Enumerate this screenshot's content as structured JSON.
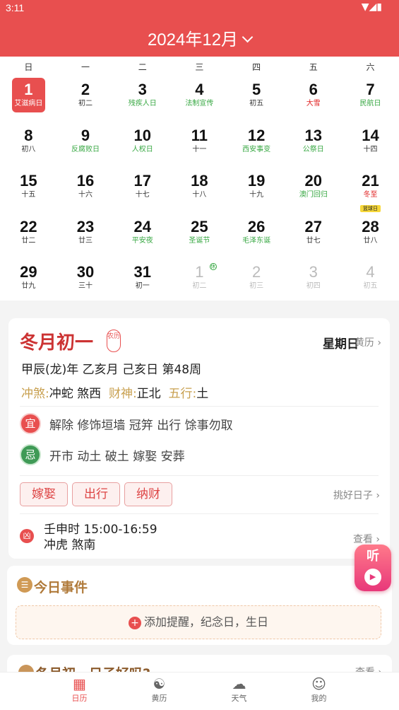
{
  "status_bar": {
    "time": "3:11",
    "icons": "▼◢▮"
  },
  "header": {
    "month_title": "2024年12月"
  },
  "weekdays": [
    "日",
    "一",
    "二",
    "三",
    "四",
    "五",
    "六"
  ],
  "days": [
    {
      "n": "1",
      "s": "艾滋病日",
      "type": "sel"
    },
    {
      "n": "2",
      "s": "初二"
    },
    {
      "n": "3",
      "s": "残疾人日",
      "type": "green"
    },
    {
      "n": "4",
      "s": "法制宣传",
      "type": "green"
    },
    {
      "n": "5",
      "s": "初五"
    },
    {
      "n": "6",
      "s": "大雪",
      "type": "red"
    },
    {
      "n": "7",
      "s": "民航日",
      "type": "green"
    },
    {
      "n": "8",
      "s": "初八"
    },
    {
      "n": "9",
      "s": "反腐败日",
      "type": "green"
    },
    {
      "n": "10",
      "s": "人权日",
      "type": "green"
    },
    {
      "n": "11",
      "s": "十一"
    },
    {
      "n": "12",
      "s": "西安事变",
      "type": "green"
    },
    {
      "n": "13",
      "s": "公祭日",
      "type": "green"
    },
    {
      "n": "14",
      "s": "十四"
    },
    {
      "n": "15",
      "s": "十五"
    },
    {
      "n": "16",
      "s": "十六"
    },
    {
      "n": "17",
      "s": "十七"
    },
    {
      "n": "18",
      "s": "十八"
    },
    {
      "n": "19",
      "s": "十九"
    },
    {
      "n": "20",
      "s": "澳门回归",
      "type": "green"
    },
    {
      "n": "21",
      "s": "冬至",
      "type": "red",
      "tag": "篮球日"
    },
    {
      "n": "22",
      "s": "廿二"
    },
    {
      "n": "23",
      "s": "廿三"
    },
    {
      "n": "24",
      "s": "平安夜",
      "type": "green"
    },
    {
      "n": "25",
      "s": "圣诞节",
      "type": "green"
    },
    {
      "n": "26",
      "s": "毛泽东诞",
      "type": "green"
    },
    {
      "n": "27",
      "s": "廿七"
    },
    {
      "n": "28",
      "s": "廿八"
    },
    {
      "n": "29",
      "s": "廿九"
    },
    {
      "n": "30",
      "s": "三十"
    },
    {
      "n": "31",
      "s": "初一"
    },
    {
      "n": "1",
      "s": "初二",
      "type": "other",
      "badge": "休"
    },
    {
      "n": "2",
      "s": "初三",
      "type": "other"
    },
    {
      "n": "3",
      "s": "初四",
      "type": "other"
    },
    {
      "n": "4",
      "s": "初五",
      "type": "other"
    }
  ],
  "almanac": {
    "lunar_date": "冬月初一",
    "nongli_badge": "农历",
    "weekday": "星期日",
    "huangli_link": "黄历",
    "ganzhi": "甲辰(龙)年 乙亥月 己亥日 第48周",
    "chongsha_key": "冲煞:",
    "chongsha_val": "冲蛇 煞西",
    "caishen_key": "财神:",
    "caishen_val": "正北",
    "wuxing_key": "五行:",
    "wuxing_val": "土",
    "yi_icon": "宜",
    "yi_text": "解除 修饰垣墙 冠笄 出行 馀事勿取",
    "ji_icon": "忌",
    "ji_text": "开市 动土 破土 嫁娶 安葬",
    "chips": [
      "嫁娶",
      "出行",
      "纳财"
    ],
    "pick_day": "挑好日子",
    "xiong_icon": "凶",
    "shichen_line1": "壬申时 15:00-16:59",
    "shichen_line2": "冲虎 煞南",
    "view": "查看"
  },
  "events": {
    "title": "今日事件",
    "add_text": "添加提醒，纪念日，生日"
  },
  "next_card": {
    "title": "冬月初一日子好吗?",
    "more": "查看"
  },
  "listen_button": {
    "label": "听"
  },
  "tabs": [
    {
      "label": "日历",
      "active": true
    },
    {
      "label": "黄历"
    },
    {
      "label": "天气"
    },
    {
      "label": "我的"
    }
  ]
}
